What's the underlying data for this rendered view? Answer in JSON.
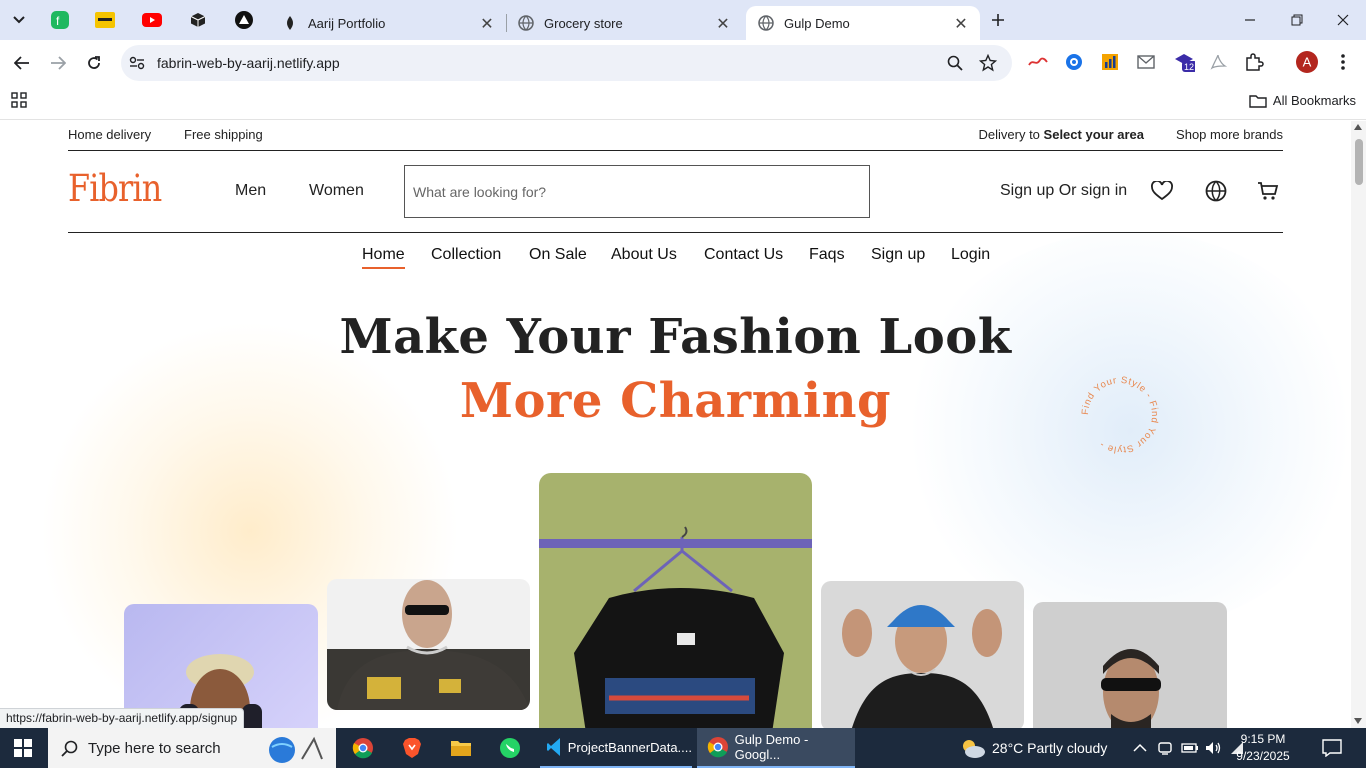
{
  "browser": {
    "pinned_tabs": [
      "fb-icon",
      "notes-icon",
      "youtube-icon",
      "box-icon",
      "vercel-icon"
    ],
    "tabs": [
      {
        "title": "Aarij Portfolio",
        "active": false
      },
      {
        "title": "Grocery store",
        "active": false
      },
      {
        "title": "Gulp Demo",
        "active": true
      }
    ],
    "url": "fabrin-web-by-aarij.netlify.app",
    "bookmarks_label": "All Bookmarks",
    "extension_badge": "12",
    "profile_initial": "A",
    "status_link": "https://fabrin-web-by-aarij.netlify.app/signup"
  },
  "site": {
    "topbar": {
      "home_delivery": "Home delivery",
      "free_shipping": "Free shipping",
      "delivery_prefix": "Delivery to",
      "delivery_area": "Select your area",
      "shop_more": "Shop more brands"
    },
    "logo": "Fibrin",
    "header_nav": [
      "Men",
      "Women"
    ],
    "search_placeholder": "What are looking for?",
    "signin": "Sign up Or sign in",
    "main_nav": [
      "Home",
      "Collection",
      "On Sale",
      "About Us",
      "Contact Us",
      "Faqs",
      "Sign up",
      "Login"
    ],
    "active_nav": "Home",
    "hero_line1": "Make Your Fashion Look",
    "hero_line2": "More Charming",
    "badge_text": "Find Your Style - Find Your Style - ",
    "accent_color": "#e8612c"
  },
  "taskbar": {
    "search_placeholder": "Type here to search",
    "apps": [
      {
        "label": "ProjectBannerData....",
        "icon": "vscode-icon"
      },
      {
        "label": "Gulp Demo - Googl...",
        "icon": "chrome-icon"
      }
    ],
    "weather": "28°C  Partly cloudy",
    "time": "9:15 PM",
    "date": "9/23/2025"
  }
}
